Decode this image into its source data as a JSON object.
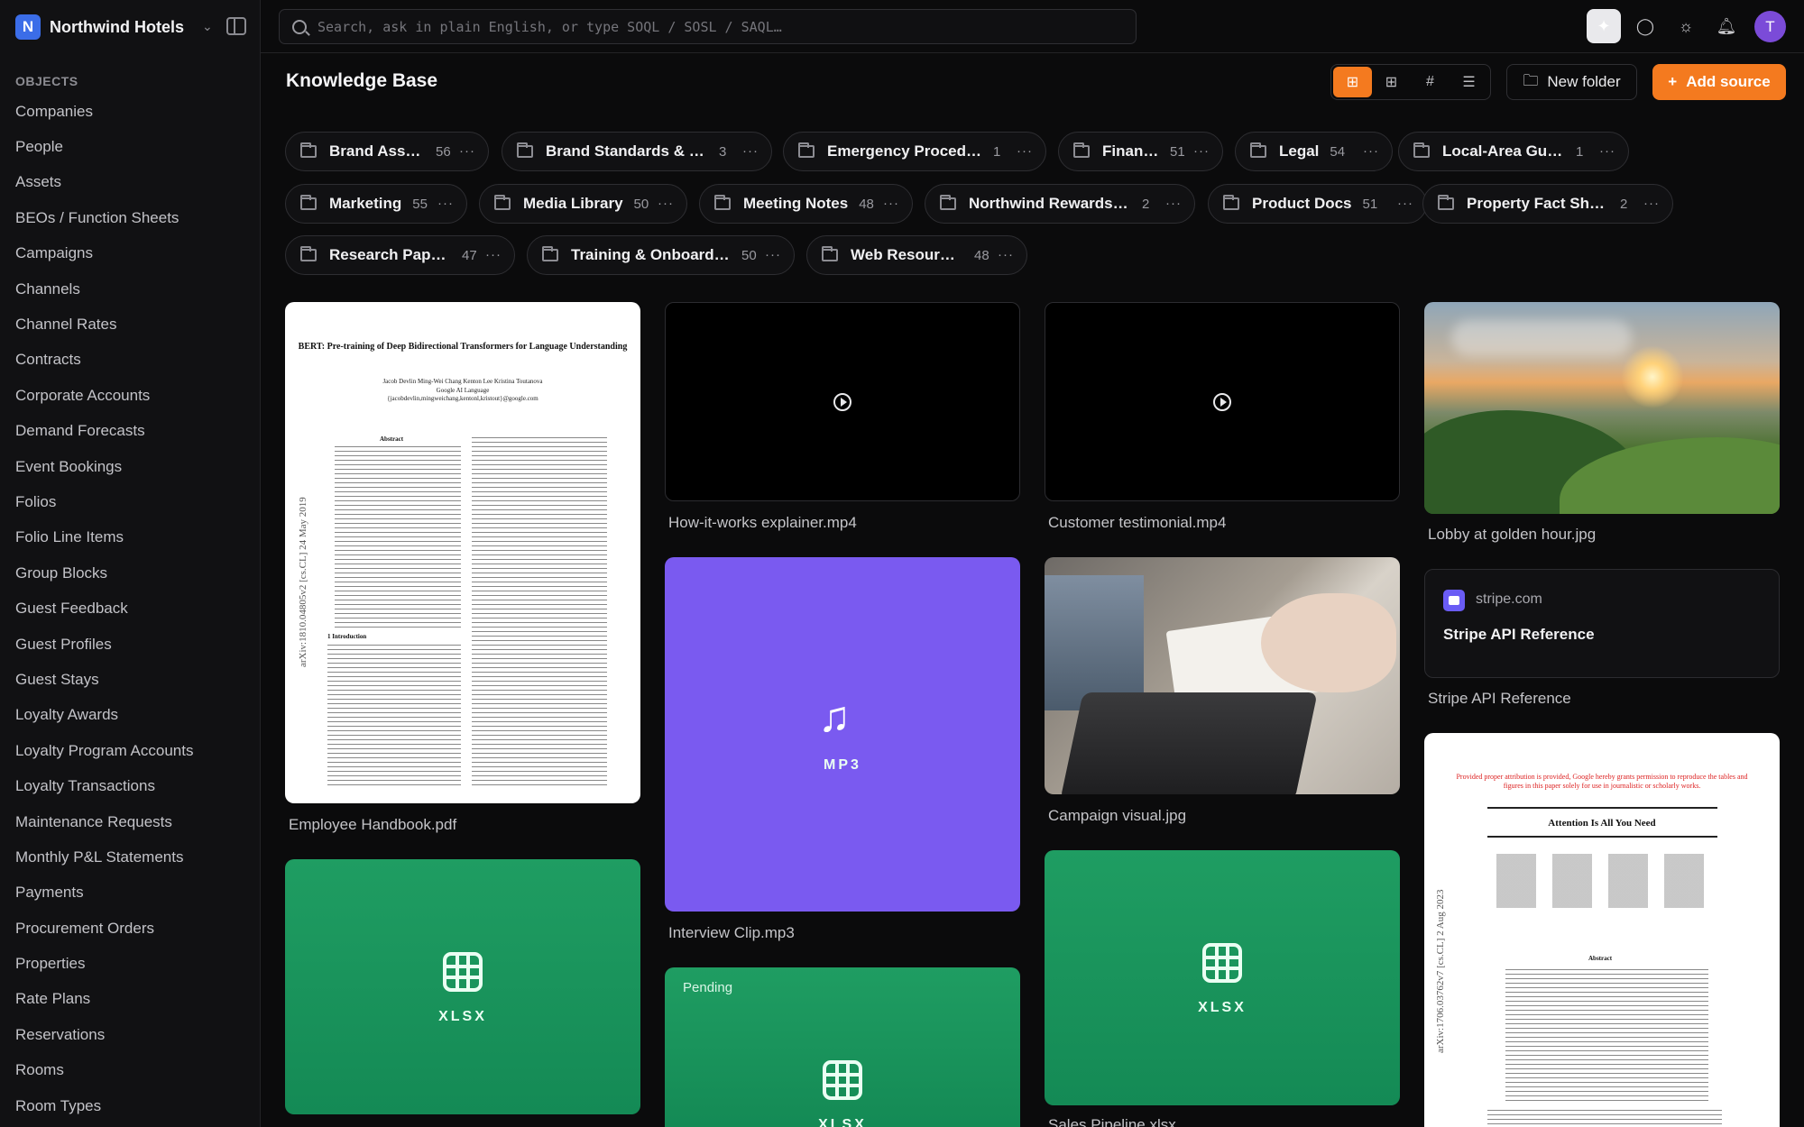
{
  "workspace": {
    "logo_letter": "N",
    "name": "Northwind Hotels"
  },
  "sidebar": {
    "section_label": "OBJECTS",
    "items": [
      "Companies",
      "People",
      "Assets",
      "BEOs / Function Sheets",
      "Campaigns",
      "Channels",
      "Channel Rates",
      "Contracts",
      "Corporate Accounts",
      "Demand Forecasts",
      "Event Bookings",
      "Folios",
      "Folio Line Items",
      "Group Blocks",
      "Guest Feedback",
      "Guest Profiles",
      "Guest Stays",
      "Loyalty Awards",
      "Loyalty Program Accounts",
      "Loyalty Transactions",
      "Maintenance Requests",
      "Monthly P&L Statements",
      "Payments",
      "Procurement Orders",
      "Properties",
      "Rate Plans",
      "Reservations",
      "Rooms",
      "Room Types"
    ]
  },
  "topbar": {
    "search_placeholder": "Search, ask in plain English, or type SOQL / SOSL / SAQL…",
    "avatar_letter": "T"
  },
  "header": {
    "title": "Knowledge Base",
    "new_folder_label": "New folder",
    "add_source_label": "Add source",
    "view_modes": [
      "masonry",
      "grid",
      "tiles",
      "list"
    ],
    "active_view": "masonry"
  },
  "folders": [
    {
      "name": "Brand Assets",
      "count": "56"
    },
    {
      "name": "Brand Standards & S...",
      "count": "3"
    },
    {
      "name": "Emergency Procedures",
      "count": "1"
    },
    {
      "name": "Finance",
      "count": "51"
    },
    {
      "name": "Legal",
      "count": "54"
    },
    {
      "name": "Local-Area Guides",
      "count": "1"
    },
    {
      "name": "Marketing",
      "count": "55"
    },
    {
      "name": "Media Library",
      "count": "50"
    },
    {
      "name": "Meeting Notes",
      "count": "48"
    },
    {
      "name": "Northwind Rewards Pr...",
      "count": "2"
    },
    {
      "name": "Product Docs",
      "count": "51"
    },
    {
      "name": "Property Fact Sheets",
      "count": "2"
    },
    {
      "name": "Research Papers",
      "count": "47"
    },
    {
      "name": "Training & Onboarding",
      "count": "50"
    },
    {
      "name": "Web Resources",
      "count": "48"
    }
  ],
  "cards": {
    "c1": {
      "caption": "Employee Handbook.pdf",
      "paper_title": "BERT: Pre-training of Deep Bidirectional Transformers for Language Understanding",
      "paper_authors": "Jacob Devlin    Ming-Wei Chang    Kenton Lee    Kristina Toutanova",
      "paper_affil": "Google AI Language",
      "paper_email": "{jacobdevlin,mingweichang,kentonl,kristout}@google.com",
      "abstract_head": "Abstract",
      "intro_head": "1    Introduction",
      "side_stamp": "arXiv:1810.04805v2  [cs.CL]  24 May 2019"
    },
    "c2": {
      "caption": "XLSX",
      "type_label": "XLSX"
    },
    "c3": {
      "caption": "How-it-works explainer.mp4"
    },
    "c4": {
      "caption": "Interview Clip.mp3",
      "type_label": "MP3"
    },
    "c5": {
      "pending": "Pending",
      "type_label": "XLSX"
    },
    "c6": {
      "caption": "Customer testimonial.mp4"
    },
    "c7": {
      "caption": "Campaign visual.jpg"
    },
    "c8": {
      "caption": "Sales Pipeline.xlsx",
      "type_label": "XLSX"
    },
    "c9": {
      "caption": "Lobby at golden hour.jpg"
    },
    "c10": {
      "caption": "Stripe API Reference",
      "domain": "stripe.com",
      "title": "Stripe API Reference"
    },
    "c11": {
      "red_note": "Provided proper attribution is provided, Google hereby grants permission to reproduce the tables and figures in this paper solely for use in journalistic or scholarly works.",
      "paper_title": "Attention Is All You Need",
      "abstract_head": "Abstract",
      "side_stamp": "arXiv:1706.03762v7  [cs.CL]  2 Aug 2023"
    }
  },
  "colors": {
    "accent": "#f47a1f",
    "xlsx": "#1f9d62",
    "mp3": "#7a5af0"
  }
}
